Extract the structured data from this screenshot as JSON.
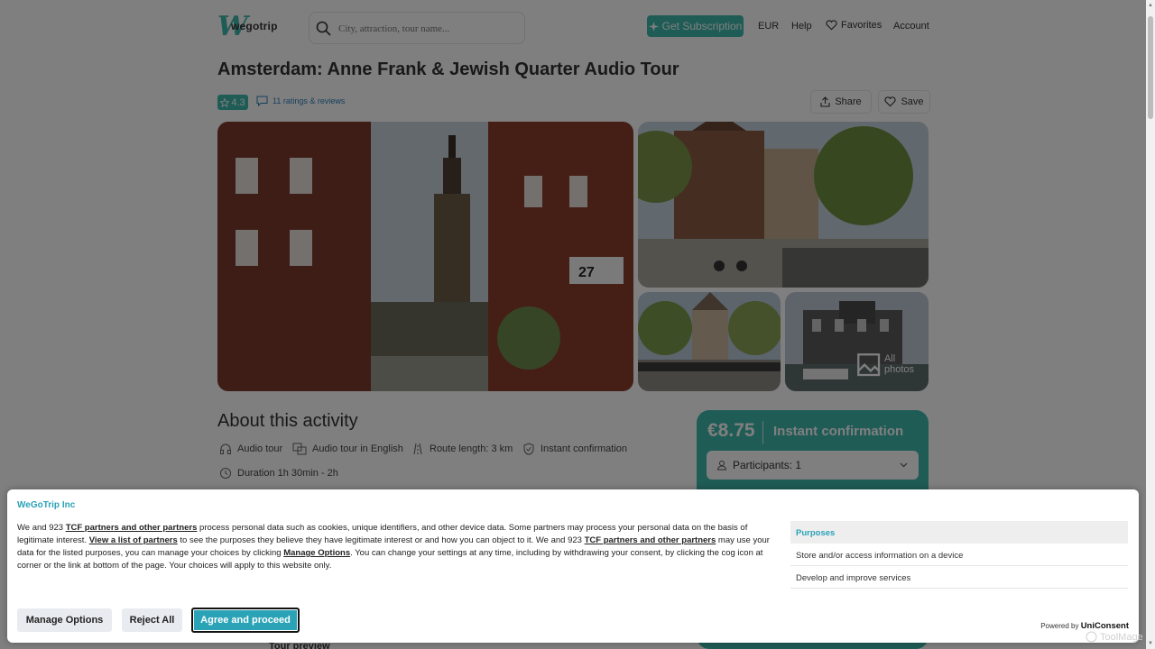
{
  "header": {
    "logo_text": "wegotrip",
    "search_placeholder": "City, attraction, tour name...",
    "subscription_label": "Get Subscription",
    "currency": "EUR",
    "help": "Help",
    "favorites": "Favorites",
    "account": "Account"
  },
  "tour": {
    "title": "Amsterdam: Anne Frank & Jewish Quarter Audio Tour",
    "rating": "4.3",
    "reviews": "11 ratings & reviews",
    "share": "Share",
    "save": "Save",
    "all_photos": "All photos"
  },
  "about": {
    "heading": "About this activity",
    "features": [
      "Audio tour",
      "Audio tour in English",
      "Route length: 3 km",
      "Instant confirmation"
    ],
    "duration": "Duration 1h 30min - 2h",
    "tour_preview": "Tour preview"
  },
  "booking": {
    "price": "€8.75",
    "confirmation": "Instant confirmation",
    "participants": "Participants: 1"
  },
  "consent": {
    "company": "WeGoTrip Inc",
    "text_1": "We and 923 ",
    "link_1": "TCF partners and other partners",
    "text_2": " process personal data such as cookies, unique identifiers, and other device data. Some partners may process your personal data on the basis of legitimate interest. ",
    "link_2": "View a list of partners",
    "text_3": " to see the purposes they believe they have legitimate interest or and how you can object to it. We and 923 ",
    "link_3": "TCF partners and other partners",
    "text_4": " may use your data for the listed purposes, you can manage your choices by clicking ",
    "link_4": "Manage Options",
    "text_5": ". You can change your settings at any time, including by withdrawing your consent, by clicking the cog icon at corner or the link at bottom of the page. Your choices will apply to this website only.",
    "purposes_heading": "Purposes",
    "purposes": [
      "Store and/or access information on a device",
      "Develop and improve services"
    ],
    "manage_btn": "Manage Options",
    "reject_btn": "Reject All",
    "agree_btn": "Agree and proceed",
    "powered_by": "Powered by ",
    "powered_brand": "UniConsent"
  },
  "watermark": "ToolMage",
  "colors": {
    "accent": "#3fb8ad",
    "consent_accent": "#2aa3b7"
  }
}
